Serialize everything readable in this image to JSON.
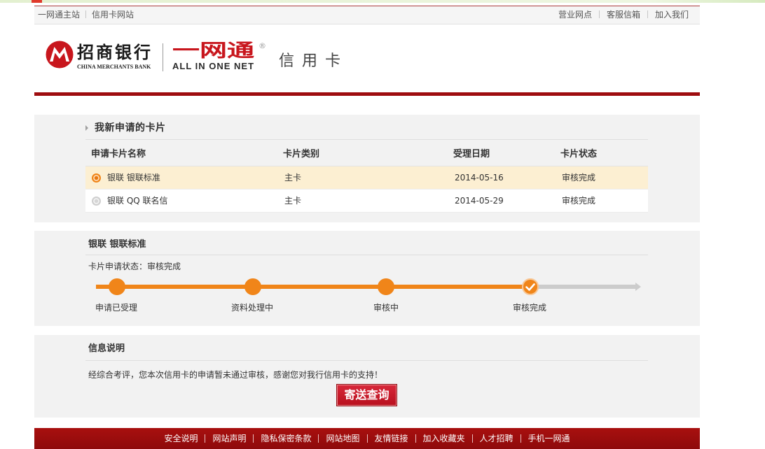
{
  "colors": {
    "brand_red": "#9e0c0f",
    "accent_orange": "#f08519",
    "row_highlight": "#fcefd2",
    "progress_gray": "#cccccc",
    "panel_gray": "#f2f2f2",
    "button_red": "#c8161d"
  },
  "icons": {
    "bank_emblem": "cmb-emblem-icon",
    "title_bullet": "arrow-right-icon",
    "row_selector": "radio-icon",
    "step_complete": "check-icon",
    "track_end": "arrow-head-icon"
  },
  "top_nav": {
    "left_links": [
      "一网通主站",
      "信用卡网站"
    ],
    "right_links": [
      "营业网点",
      "客服信箱",
      "加入我们"
    ]
  },
  "header": {
    "bank_name": "招商银行",
    "bank_name_en": "CHINA MERCHANTS BANK",
    "portal_name": "一网通",
    "portal_name_en": "ALL IN ONE NET",
    "registered_mark": "®",
    "section_name": "信用卡"
  },
  "my_cards": {
    "title": "我新申请的卡片",
    "columns": [
      "申请卡片名称",
      "卡片类别",
      "受理日期",
      "卡片状态"
    ],
    "rows": [
      {
        "name": "银联 银联标准",
        "type": "主卡",
        "date": "2014-05-16",
        "status": "审核完成",
        "selected": true
      },
      {
        "name": "银联 QQ 联名信",
        "type": "主卡",
        "date": "2014-05-29",
        "status": "审核完成",
        "selected": false
      }
    ]
  },
  "progress": {
    "card_name": "银联 银联标准",
    "status_label": "卡片申请状态：",
    "status_value": "审核完成",
    "steps": [
      "申请已受理",
      "资料处理中",
      "审核中",
      "审核完成"
    ],
    "completed_steps": 4,
    "current_step": 4
  },
  "info": {
    "title": "信息说明",
    "message": "经综合考评，您本次信用卡的申请暂未通过审核，感谢您对我行信用卡的支持！",
    "button_label": "寄送查询"
  },
  "footer": {
    "links": [
      "安全说明",
      "网站声明",
      "隐私保密条款",
      "网站地图",
      "友情链接",
      "加入收藏夹",
      "人才招聘",
      "手机一网通"
    ]
  }
}
